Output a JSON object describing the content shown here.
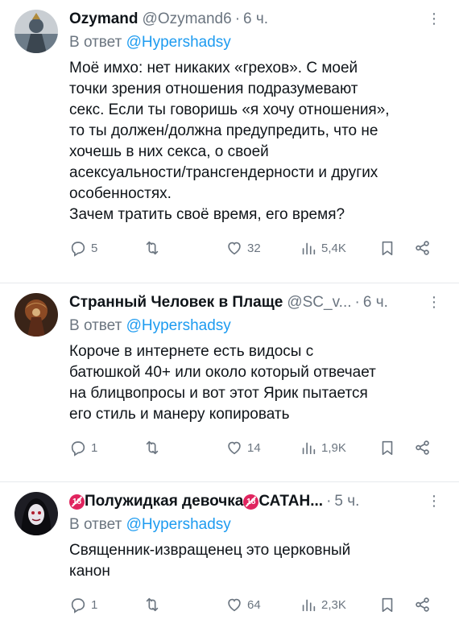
{
  "tweets": [
    {
      "name": "Ozymand",
      "handle": "@Ozymand6",
      "time": "6 ч.",
      "reply_prefix": "В ответ",
      "reply_to": "@Hypershadsy",
      "text": "Моё имхо: нет никаких «грехов». С моей\nточки зрения отношения подразумевают\nсекс. Если ты говоришь «я хочу отношения»,\nто ты должен/должна предупредить, что не\nхочешь в них секса, о своей\nасексуальности/трансгендерности и других\nособенностях.\nЗачем тратить своё время, его время?",
      "replies": "5",
      "retweets": "",
      "likes": "32",
      "views": "5,4K",
      "avatar_color": "#5a6b7a"
    },
    {
      "name": "Странный Человек в Плаще",
      "handle": "@SC_v...",
      "time": "6 ч.",
      "reply_prefix": "В ответ",
      "reply_to": "@Hypershadsy",
      "text": "Короче в интернете есть видосы с\nбатюшкой 40+ или около который отвечает\nна блицвопросы и вот этот Ярик пытается\nего стиль и манеру копировать",
      "replies": "1",
      "retweets": "",
      "likes": "14",
      "views": "1,9K",
      "avatar_color": "#7a3b22"
    },
    {
      "name_part1": "Полужидкая девочка",
      "name_part2": "САТАН...",
      "emoji": "18",
      "time": "5 ч.",
      "reply_prefix": "В ответ",
      "reply_to": "@Hypershadsy",
      "text": "Священник-извращенец это церковный\nканон",
      "replies": "1",
      "retweets": "",
      "likes": "64",
      "views": "2,3K",
      "avatar_color": "#2a2a33"
    }
  ],
  "more_glyph": "⋮",
  "dot": "·",
  "icons": [
    "reply-icon",
    "retweet-icon",
    "like-icon",
    "views-icon",
    "bookmark-icon",
    "share-icon"
  ],
  "colors": {
    "accent": "#1d9bf0",
    "muted": "#6b7580",
    "text": "#0f1419"
  }
}
